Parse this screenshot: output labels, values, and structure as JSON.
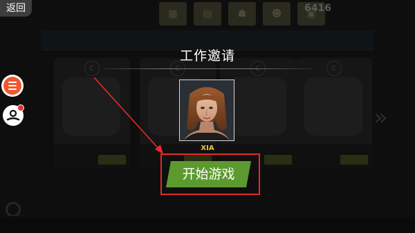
{
  "back_button": {
    "label": "返回"
  },
  "dialog": {
    "title": "工作邀请",
    "character_name": "XIA",
    "start_button_label": "开始游戏"
  },
  "background": {
    "coins_value": "6416",
    "game_cards": [
      {
        "badge": "C"
      },
      {
        "badge": "C"
      },
      {
        "badge": "C"
      },
      {
        "badge": "C"
      }
    ]
  },
  "side_buttons": {
    "menu_icon": "hamburger-menu-icon",
    "profile_icon": "profile-icon",
    "profile_has_notification": true
  },
  "colors": {
    "start_button": "#5c9a2f",
    "highlight": "#e62a2a",
    "character_name": "#f0c53c",
    "menu_accent": "#f2572f"
  }
}
